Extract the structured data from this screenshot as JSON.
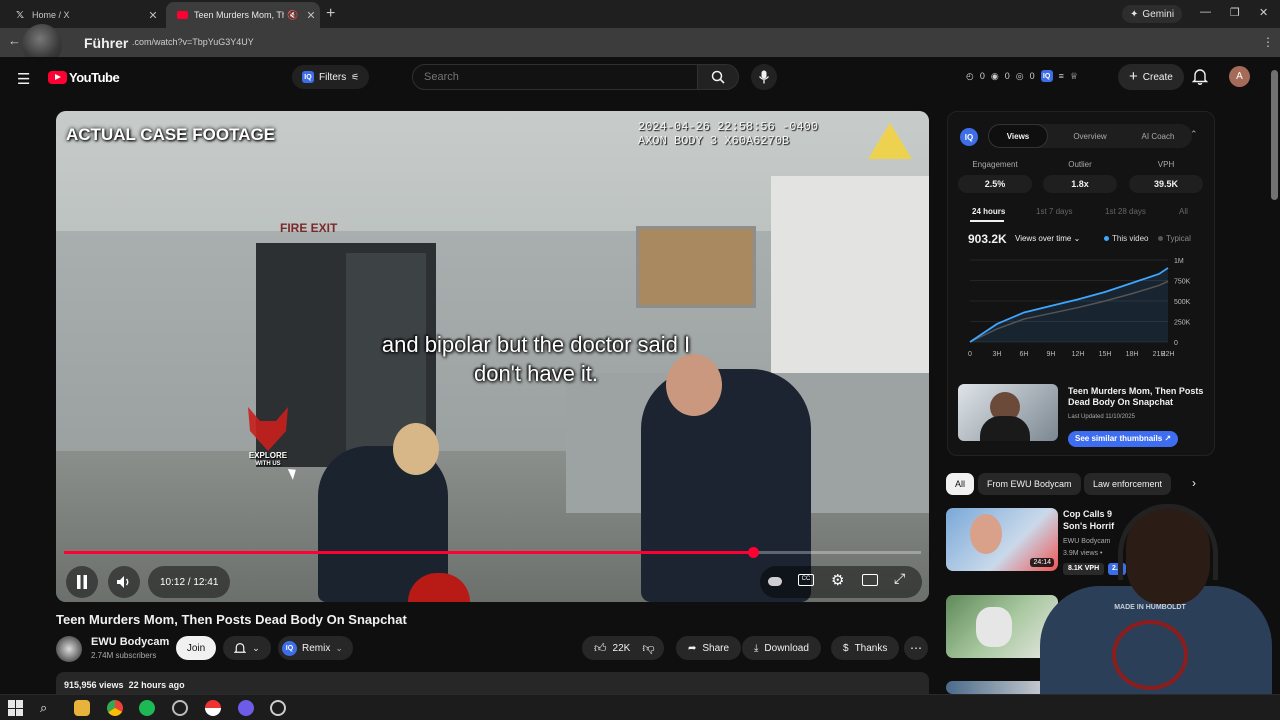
{
  "browser": {
    "tabs": [
      {
        "title": "Home / X",
        "icon": "x-logo-icon"
      },
      {
        "title": "Teen Murders Mom, Then P",
        "icon": "youtube-icon"
      }
    ],
    "gemini_label": "Gemini",
    "url": ".com/watch?v=TbpYuG3Y4UY",
    "overlay_name": "Führer",
    "profile_initial": "A"
  },
  "header": {
    "logo_text": "YouTube",
    "filters_label": "Filters",
    "search_placeholder": "Search",
    "stats": [
      "0",
      "0",
      "0"
    ],
    "create_label": "Create",
    "account_initial": "A"
  },
  "player": {
    "case_label": "ACTUAL CASE FOOTAGE",
    "stamp_line1": "2024-04-26 22:58:56 -0400",
    "stamp_line2": "AXON BODY 3 X60A6270B",
    "fire_exit": "FIRE EXIT",
    "subtitle": "and bipolar but the doctor said I don't have it.",
    "watermark_line1": "EXPLORE",
    "watermark_line2": "WITH US",
    "time": "10:12 / 12:41",
    "progress_fraction": 0.804,
    "accent": "#ff0033"
  },
  "video": {
    "title": "Teen Murders Mom, Then Posts Dead Body On Snapchat",
    "channel": "EWU Bodycam",
    "subscribers": "2.74M subscribers",
    "join_label": "Join",
    "remix_label": "Remix",
    "likes": "22K",
    "share_label": "Share",
    "download_label": "Download",
    "thanks_label": "Thanks",
    "views": "915,956 views",
    "age": "22 hours ago"
  },
  "panel": {
    "logo": "IQ",
    "tabs": [
      "Views",
      "Overview",
      "AI Coach"
    ],
    "active_tab": "Views",
    "metrics": [
      {
        "label": "Engagement",
        "value": "2.5%"
      },
      {
        "label": "Outlier",
        "value": "1.8x"
      },
      {
        "label": "VPH",
        "value": "39.5K"
      }
    ],
    "ranges": [
      "24 hours",
      "1st 7 days",
      "1st 28 days",
      "All"
    ],
    "total_views": "903.2K",
    "views_dropdown": "Views over time",
    "legend_this": "This video",
    "legend_typical": "Typical",
    "card_title": "Teen Murders Mom, Then Posts Dead Body On Snapchat",
    "card_date": "Last Updated 11/10/2025",
    "similar_label": "See similar thumbnails"
  },
  "chart_data": {
    "type": "line",
    "x_labels": [
      "0",
      "3H",
      "6H",
      "9H",
      "12H",
      "15H",
      "18H",
      "21H",
      "22H"
    ],
    "y_labels": [
      "1M",
      "750K",
      "500K",
      "250K",
      "0"
    ],
    "ylim": [
      0,
      1000000
    ],
    "series": [
      {
        "name": "This video",
        "x": [
          0,
          3,
          6,
          9,
          12,
          15,
          18,
          21,
          22
        ],
        "values": [
          0,
          220000,
          360000,
          440000,
          520000,
          610000,
          720000,
          830000,
          903200
        ]
      },
      {
        "name": "Typical",
        "x": [
          0,
          3,
          6,
          9,
          12,
          15,
          18,
          21,
          22
        ],
        "values": [
          0,
          160000,
          280000,
          350000,
          420000,
          500000,
          590000,
          690000,
          740000
        ]
      }
    ],
    "colors": {
      "this": "#3ea6ff",
      "typical": "#555555"
    }
  },
  "chips": [
    "All",
    "From EWU Bodycam",
    "Law enforcement"
  ],
  "recommendations": [
    {
      "title_line1": "Cop Calls 9",
      "title_line2": "Son's Horrif",
      "channel": "EWU Bodycam",
      "meta": "3.9M views •",
      "duration": "24:14",
      "vph": "8.1K VPH",
      "score": "2.3"
    },
    {
      "title_line1": "",
      "title_line2": "",
      "channel": "",
      "meta": "",
      "duration": "",
      "vph": "",
      "score": ""
    }
  ],
  "webcam": {
    "shirt_text": "MADE IN HUMBOLDT"
  }
}
